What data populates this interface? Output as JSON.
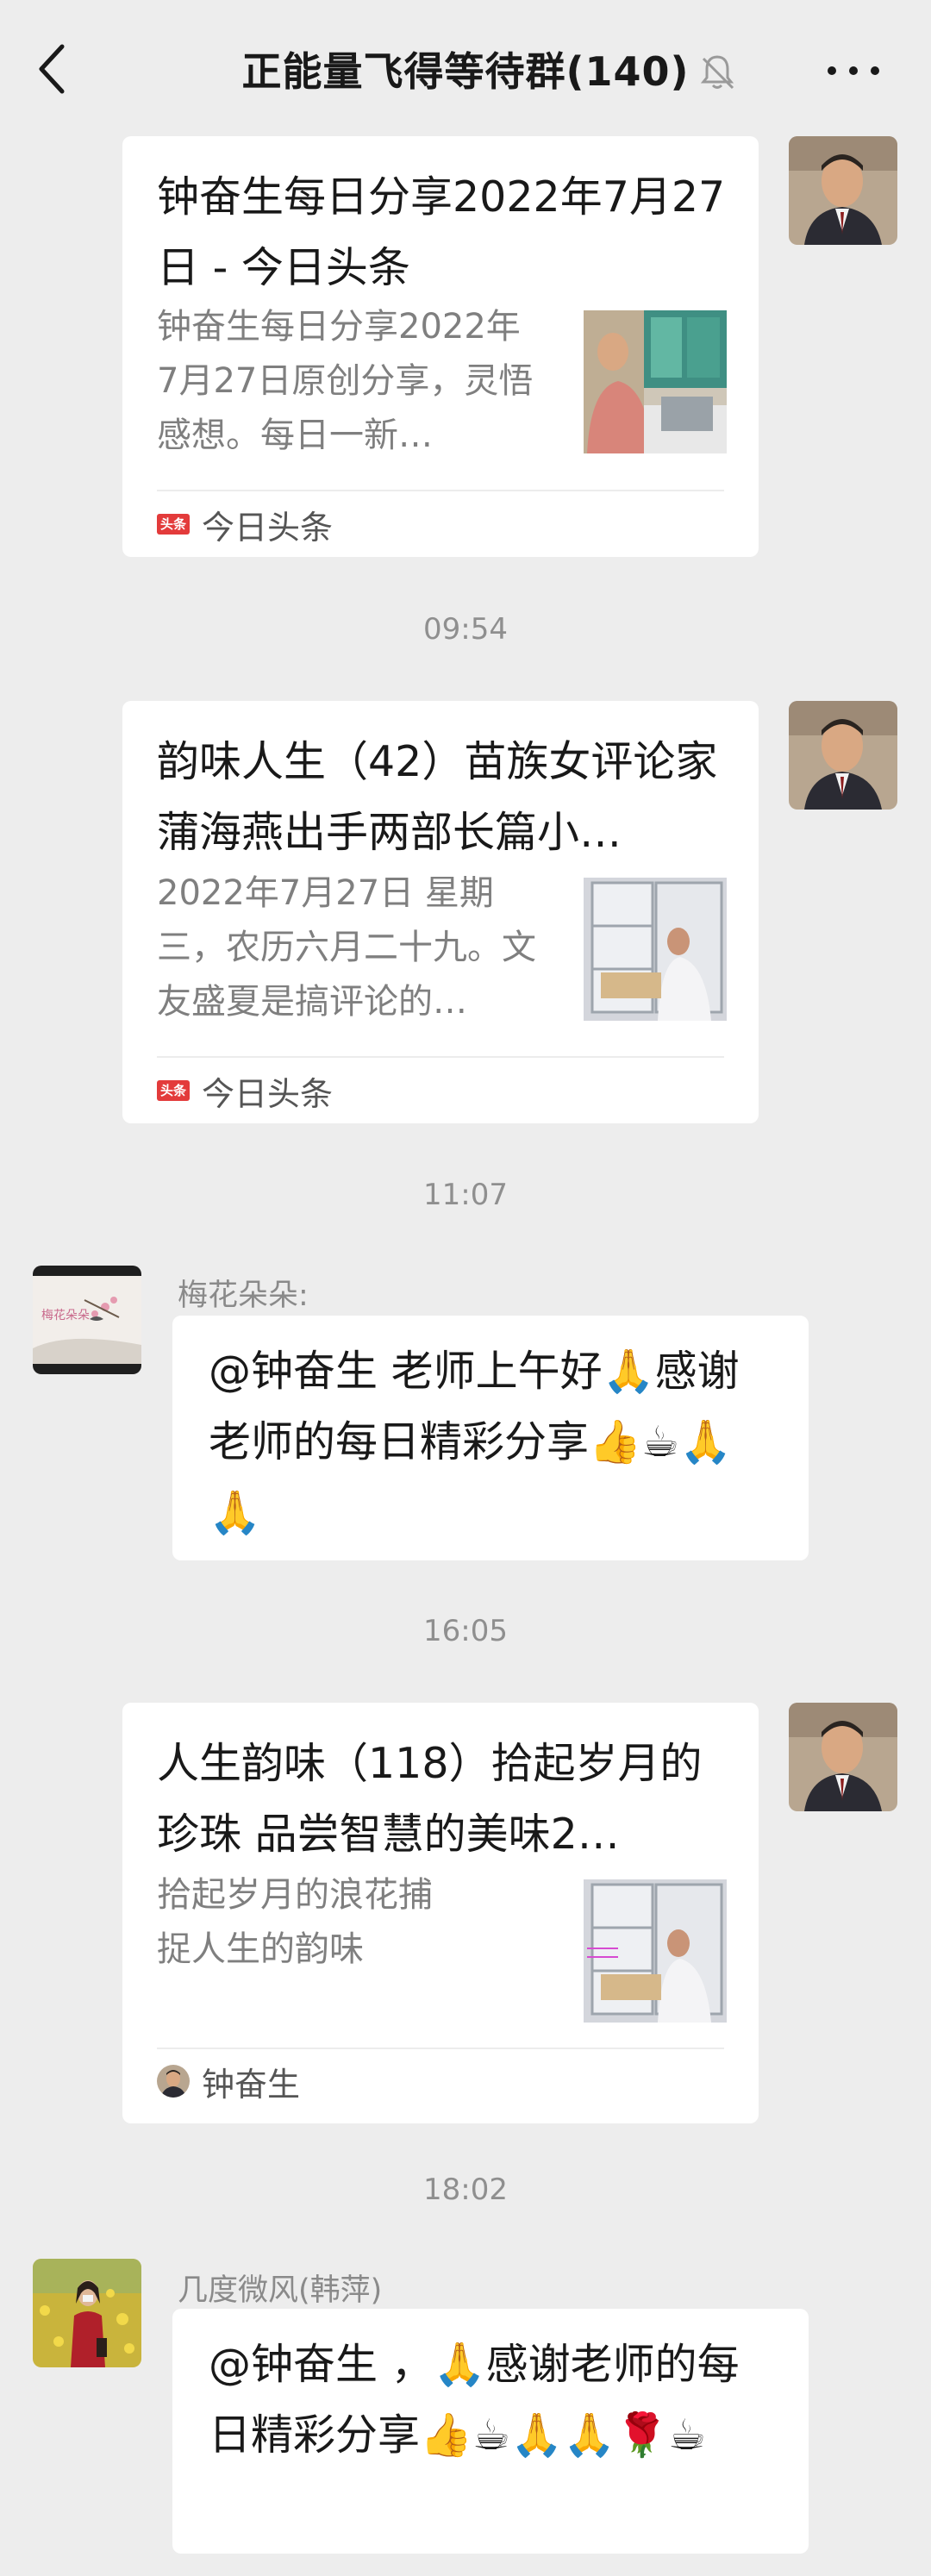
{
  "header": {
    "title": "正能量飞得等待群(140)",
    "back_icon": "chevron-left-icon",
    "mute_icon": "bell-off-icon",
    "more_icon": "more-dots-icon"
  },
  "messages": [
    {
      "type": "link",
      "title": "钟奋生每日分享2022年7月27日 - 今日头条",
      "description": "钟奋生每日分享2022年7月27日原创分享，灵悟感想。每日一新…",
      "source": "今日头条",
      "source_logo": "头条"
    },
    {
      "type": "time",
      "text": "09:54"
    },
    {
      "type": "link",
      "title": "韵味人生（42）苗族女评论家蒲海燕出手两部长篇小…",
      "description": "2022年7月27日 星期三，农历六月二十九。文友盛夏是搞评论的…",
      "source": "今日头条",
      "source_logo": "头条"
    },
    {
      "type": "time",
      "text": "11:07"
    },
    {
      "type": "text",
      "sender": "梅花朵朵:",
      "text": "@钟奋生  老师上午好🙏感谢老师的每日精彩分享👍☕🙏🙏"
    },
    {
      "type": "time",
      "text": "16:05"
    },
    {
      "type": "link",
      "title": "人生韵味（118）拾起岁月的珍珠 品尝智慧的美味2…",
      "description": "拾起岁月的浪花捕捉人生的韵味",
      "source": "钟奋生"
    },
    {
      "type": "time",
      "text": "18:02"
    },
    {
      "type": "text",
      "sender": "几度微风(韩萍)",
      "text": "@钟奋生 ，🙏感谢老师的每日精彩分享👍☕🙏🙏🌹☕"
    }
  ]
}
